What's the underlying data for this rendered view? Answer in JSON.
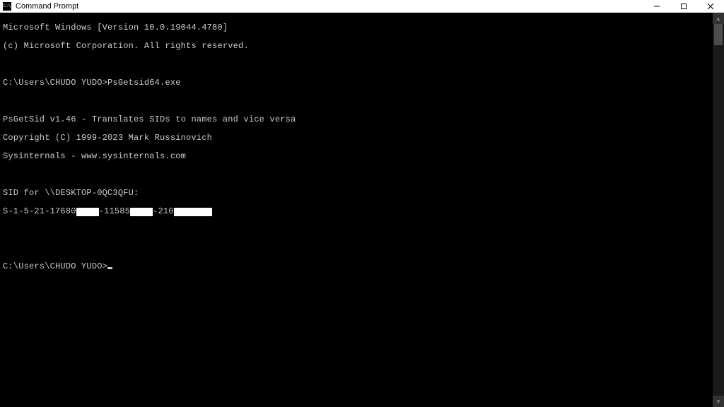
{
  "window": {
    "title": "Command Prompt"
  },
  "terminal": {
    "line_version": "Microsoft Windows [Version 10.0.19044.4780]",
    "line_copyright": "(c) Microsoft Corporation. All rights reserved.",
    "prompt1_path": "C:\\Users\\CHUDO YUDO>",
    "prompt1_cmd": "PsGetsid64.exe",
    "tool_header": "PsGetSid v1.46 - Translates SIDs to names and vice versa",
    "tool_copyright": "Copyright (C) 1999-2023 Mark Russinovich",
    "tool_site": "Sysinternals - www.sysinternals.com",
    "sid_for": "SID for \\\\DESKTOP-0QC3QFU:",
    "sid_part1": "S-1-5-21-17680",
    "sid_part2": "-11585",
    "sid_part3": "-210",
    "prompt2_path": "C:\\Users\\CHUDO YUDO>"
  }
}
